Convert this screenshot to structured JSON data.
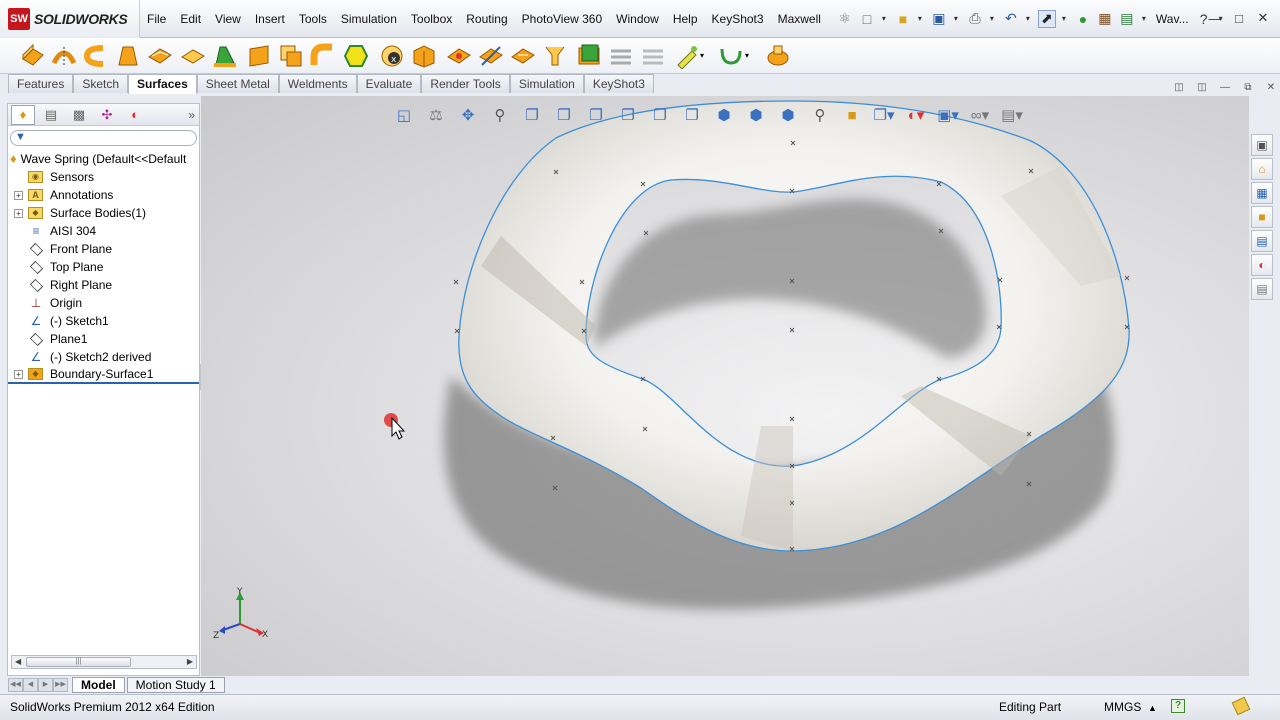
{
  "app": {
    "logo_text": "SOLIDWORKS",
    "logo_mark": "SW",
    "window_title": "Wav..."
  },
  "menu": [
    "File",
    "Edit",
    "View",
    "Insert",
    "Tools",
    "Simulation",
    "Toolbox",
    "Routing",
    "PhotoView 360",
    "Window",
    "Help",
    "KeyShot3",
    "Maxwell"
  ],
  "quick_tools": [
    "pin-icon",
    "new-document-icon",
    "open-folder-icon",
    "save-icon",
    "print-icon",
    "undo-icon",
    "select-arrow-icon",
    "rebuild-traffic-light-icon",
    "file-properties-icon",
    "options-icon"
  ],
  "tabs": {
    "items": [
      "Features",
      "Sketch",
      "Surfaces",
      "Sheet Metal",
      "Weldments",
      "Evaluate",
      "Render Tools",
      "Simulation",
      "KeyShot3"
    ],
    "active": "Surfaces"
  },
  "feature_tree": {
    "root": "Wave Spring  (Default<<Default",
    "items": [
      {
        "label": "Sensors",
        "icon": "sensor-folder-icon",
        "expandable": false
      },
      {
        "label": "Annotations",
        "icon": "annotations-icon",
        "expandable": true
      },
      {
        "label": "Surface Bodies(1)",
        "icon": "surface-bodies-folder-icon",
        "expandable": true
      },
      {
        "label": "AISI 304",
        "icon": "material-icon",
        "expandable": false
      },
      {
        "label": "Front Plane",
        "icon": "plane-icon",
        "expandable": false
      },
      {
        "label": "Top Plane",
        "icon": "plane-icon",
        "expandable": false
      },
      {
        "label": "Right Plane",
        "icon": "plane-icon",
        "expandable": false
      },
      {
        "label": "Origin",
        "icon": "origin-icon",
        "expandable": false
      },
      {
        "label": "(-) Sketch1",
        "icon": "sketch-icon",
        "expandable": false
      },
      {
        "label": "Plane1",
        "icon": "plane-icon",
        "expandable": false
      },
      {
        "label": "(-) Sketch2 derived",
        "icon": "sketch-icon",
        "expandable": false
      },
      {
        "label": "Boundary-Surface1",
        "icon": "boundary-surface-icon",
        "expandable": true
      }
    ]
  },
  "bottom_tabs": {
    "items": [
      "Model",
      "Motion Study 1"
    ],
    "active": "Model"
  },
  "status": {
    "edition": "SolidWorks Premium 2012 x64 Edition",
    "mode": "Editing Part",
    "units": "MMGS"
  },
  "axis_triad": {
    "x": "X",
    "y": "Y",
    "z": "Z"
  },
  "colors": {
    "accent_blue": "#2a62b0",
    "brand_red": "#c4161c",
    "tool_orange": "#f5a21b",
    "surface_edge": "#3b8fd6"
  }
}
